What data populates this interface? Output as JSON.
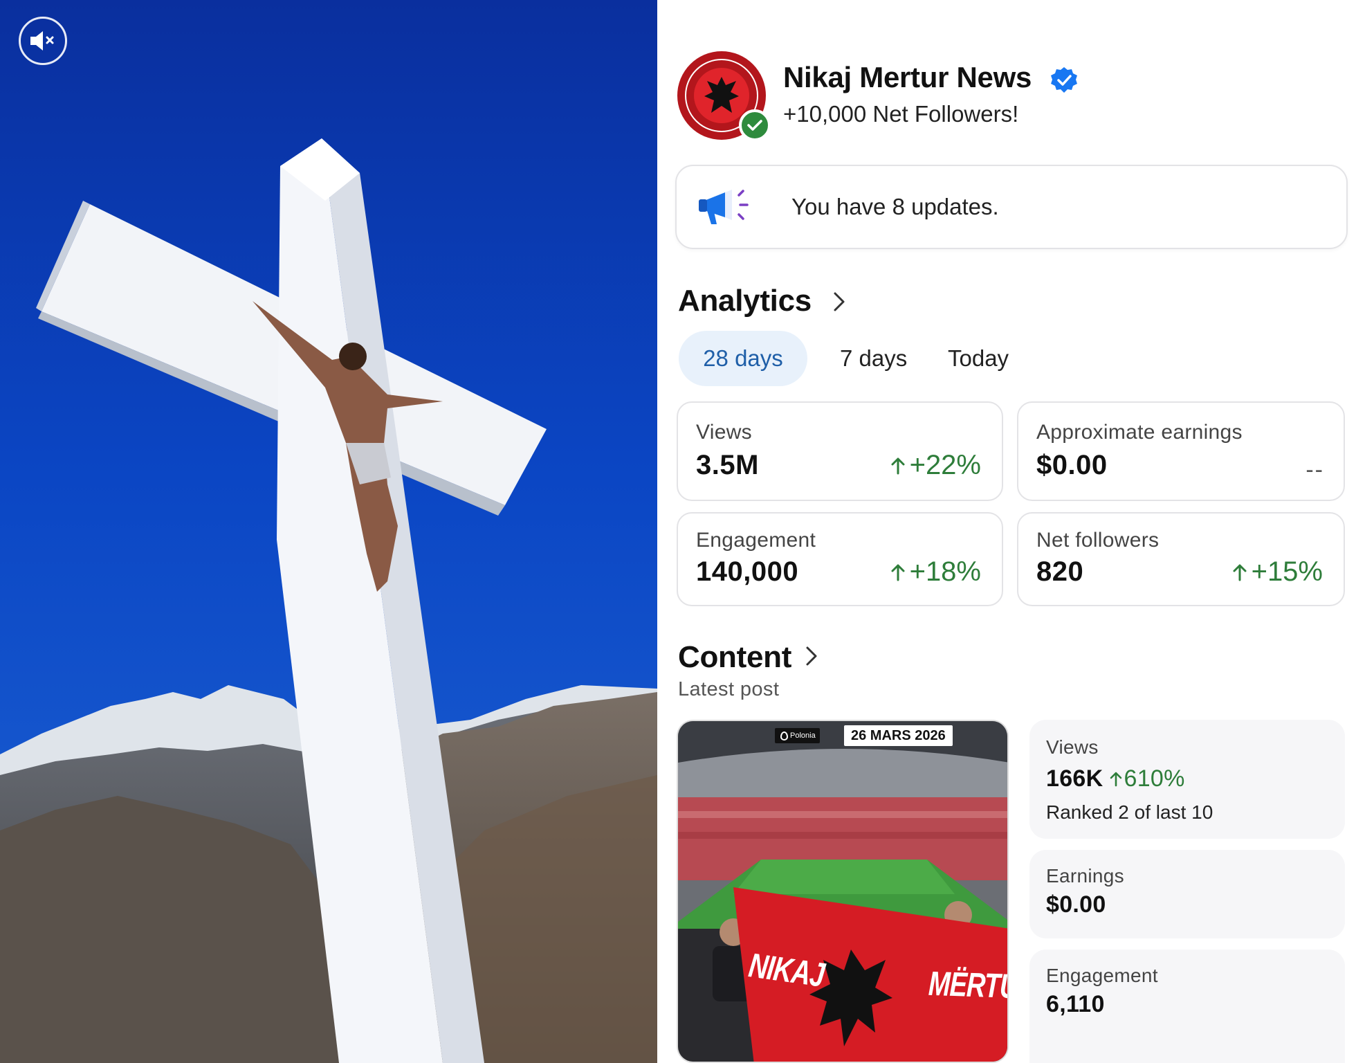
{
  "profile": {
    "name": "Nikaj Mertur News",
    "subtitle": "+10,000 Net Followers!",
    "avatar_icon": "albanian-eagle-logo",
    "verified_icon": "verified-badge-icon",
    "verified_color": "#1877f2"
  },
  "updates": {
    "text": "You have 8 updates.",
    "icon": "megaphone-icon"
  },
  "analytics": {
    "title": "Analytics",
    "tabs": [
      {
        "label": "28 days",
        "selected": true
      },
      {
        "label": "7 days",
        "selected": false
      },
      {
        "label": "Today",
        "selected": false
      }
    ],
    "cards": {
      "views": {
        "label": "Views",
        "value": "3.5M",
        "change": "+22%"
      },
      "earnings": {
        "label": "Approximate earnings",
        "value": "$0.00",
        "change": "--"
      },
      "engagement": {
        "label": "Engagement",
        "value": "140,000",
        "change": "+18%"
      },
      "followers": {
        "label": "Net followers",
        "value": "820",
        "change": "+15%"
      }
    },
    "positive_color": "#2e7d3a"
  },
  "content": {
    "title": "Content",
    "latest_label": "Latest post",
    "thumbnail": {
      "date_badge": "26 MARS 2026",
      "location_badge": "Polonia",
      "flag_text_left": "NIKAJ",
      "flag_text_right": "MËRTUR"
    },
    "metrics": {
      "views": {
        "label": "Views",
        "value": "166K",
        "change": "610%",
        "rank": "Ranked 2 of last 10"
      },
      "earnings": {
        "label": "Earnings",
        "value": "$0.00"
      },
      "engagement": {
        "label": "Engagement",
        "value": "6,110"
      }
    }
  },
  "video": {
    "mute_icon": "speaker-muted-icon"
  }
}
